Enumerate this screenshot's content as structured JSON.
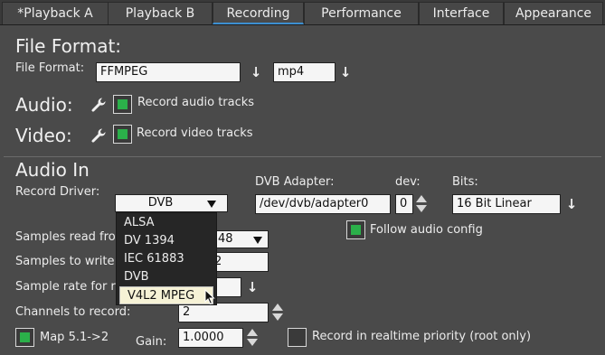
{
  "tabs": [
    {
      "label": "*Playback A"
    },
    {
      "label": "Playback B"
    },
    {
      "label": "Recording"
    },
    {
      "label": "Performance"
    },
    {
      "label": "Interface"
    },
    {
      "label": "Appearance"
    }
  ],
  "file_format": {
    "heading": "File Format:",
    "label": "File Format:",
    "format_value": "FFMPEG",
    "ext_value": "mp4"
  },
  "audio": {
    "heading": "Audio:",
    "record_label": "Record audio tracks",
    "record_checked": true
  },
  "video": {
    "heading": "Video:",
    "record_label": "Record video tracks",
    "record_checked": true
  },
  "audio_in": {
    "heading": "Audio In",
    "record_driver_label": "Record Driver:",
    "record_driver_value": "DVB",
    "driver_options": [
      "ALSA",
      "DV 1394",
      "IEC 61883",
      "DVB",
      "V4L2 MPEG"
    ],
    "highlighted_option": "V4L2 MPEG",
    "dvb_adapter_label": "DVB Adapter:",
    "dvb_adapter_value": "/dev/dvb/adapter0",
    "dev_label": "dev:",
    "dev_value": "0",
    "bits_label": "Bits:",
    "bits_value": "16 Bit Linear",
    "follow_label": "Follow audio config",
    "follow_checked": true,
    "samples_read_label": "Samples read fro",
    "samples_read_value": "48",
    "samples_write_label": "Samples to write",
    "samples_write_value": "2",
    "sample_rate_label": "Sample rate for r",
    "channels_label": "Channels to record:",
    "channels_value": "2",
    "map_label": "Map 5.1->2",
    "map_checked": true,
    "gain_label": "Gain:",
    "gain_value": "1.0000",
    "realtime_label": "Record in realtime priority (root only)",
    "realtime_checked": false
  }
}
